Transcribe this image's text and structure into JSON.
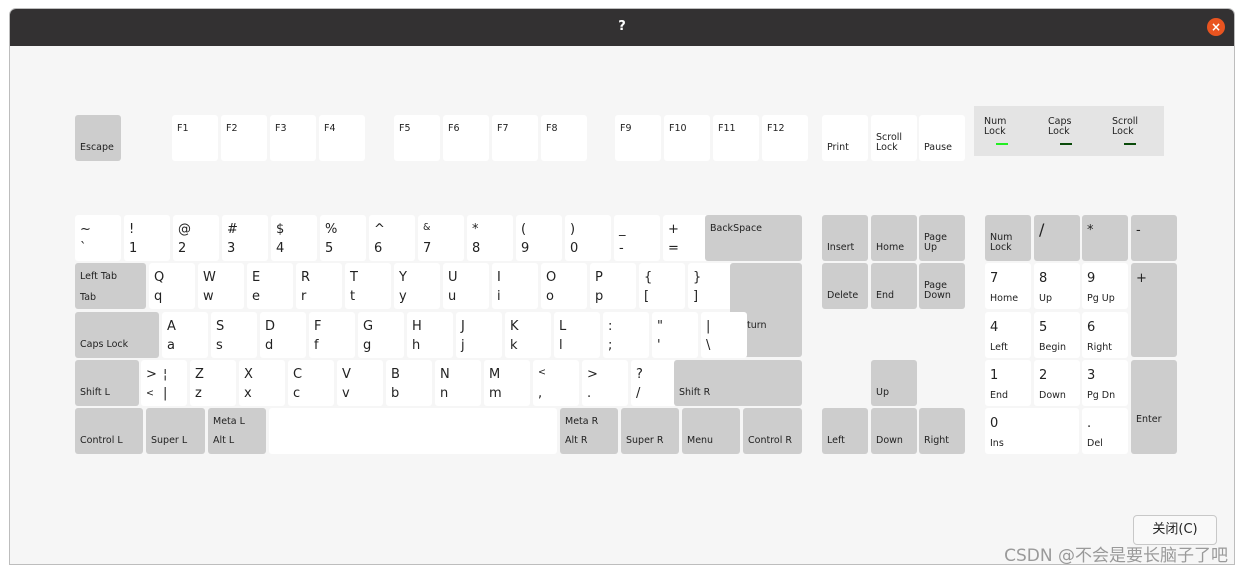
{
  "window": {
    "title": "?",
    "close_label": "×"
  },
  "colors": {
    "accent_close": "#e95420",
    "led_on": "#22ee22",
    "led_off": "#0a4a0a",
    "mod_key": "#cdcdcd",
    "key": "#ffffff"
  },
  "fn_row": {
    "escape": "Escape",
    "f": [
      "F1",
      "F2",
      "F3",
      "F4",
      "F5",
      "F6",
      "F7",
      "F8",
      "F9",
      "F10",
      "F11",
      "F12"
    ],
    "print": "Print",
    "scroll_lock": "Scroll\nLock",
    "pause": "Pause"
  },
  "leds": [
    {
      "label": "Num\nLock",
      "state": "on"
    },
    {
      "label": "Caps\nLock",
      "state": "off"
    },
    {
      "label": "Scroll\nLock",
      "state": "off"
    }
  ],
  "number_row": [
    {
      "top": "~",
      "bottom": "`"
    },
    {
      "top": "!",
      "bottom": "1"
    },
    {
      "top": "@",
      "bottom": "2"
    },
    {
      "top": "#",
      "bottom": "3"
    },
    {
      "top": "$",
      "bottom": "4"
    },
    {
      "top": "%",
      "bottom": "5"
    },
    {
      "top": "^",
      "bottom": "6"
    },
    {
      "top": "&",
      "bottom": "7"
    },
    {
      "top": "*",
      "bottom": "8"
    },
    {
      "top": "(",
      "bottom": "9"
    },
    {
      "top": ")",
      "bottom": "0"
    },
    {
      "top": "_",
      "bottom": "-"
    },
    {
      "top": "+",
      "bottom": "="
    }
  ],
  "backspace": "BackSpace",
  "tab": {
    "top": "Left Tab",
    "bottom": "Tab"
  },
  "qwerty_row": [
    {
      "top": "Q",
      "bottom": "q"
    },
    {
      "top": "W",
      "bottom": "w"
    },
    {
      "top": "E",
      "bottom": "e"
    },
    {
      "top": "R",
      "bottom": "r"
    },
    {
      "top": "T",
      "bottom": "t"
    },
    {
      "top": "Y",
      "bottom": "y"
    },
    {
      "top": "U",
      "bottom": "u"
    },
    {
      "top": "I",
      "bottom": "i"
    },
    {
      "top": "O",
      "bottom": "o"
    },
    {
      "top": "P",
      "bottom": "p"
    },
    {
      "top": "{",
      "bottom": "["
    },
    {
      "top": "}",
      "bottom": "]"
    }
  ],
  "caps_lock": "Caps Lock",
  "home_row": [
    {
      "top": "A",
      "bottom": "a"
    },
    {
      "top": "S",
      "bottom": "s"
    },
    {
      "top": "D",
      "bottom": "d"
    },
    {
      "top": "F",
      "bottom": "f"
    },
    {
      "top": "G",
      "bottom": "g"
    },
    {
      "top": "H",
      "bottom": "h"
    },
    {
      "top": "J",
      "bottom": "j"
    },
    {
      "top": "K",
      "bottom": "k"
    },
    {
      "top": "L",
      "bottom": "l"
    },
    {
      "top": ":",
      "bottom": ";"
    },
    {
      "top": "\"",
      "bottom": "'"
    },
    {
      "top": "|",
      "bottom": "\\"
    }
  ],
  "return": "Return",
  "shift_l": "Shift L",
  "iso_key": {
    "top": ">",
    "top2": "¦",
    "bottom": "<",
    "bottom2": "|"
  },
  "bottom_row_letters": [
    {
      "top": "Z",
      "bottom": "z"
    },
    {
      "top": "X",
      "bottom": "x"
    },
    {
      "top": "C",
      "bottom": "c"
    },
    {
      "top": "V",
      "bottom": "v"
    },
    {
      "top": "B",
      "bottom": "b"
    },
    {
      "top": "N",
      "bottom": "n"
    },
    {
      "top": "M",
      "bottom": "m"
    },
    {
      "top": "<",
      "bottom": ","
    },
    {
      "top": ">",
      "bottom": "."
    },
    {
      "top": "?",
      "bottom": "/"
    }
  ],
  "shift_r": "Shift R",
  "space_row": {
    "control_l": "Control L",
    "super_l": "Super L",
    "meta_l": "Meta L",
    "alt_l": "Alt L",
    "meta_r": "Meta R",
    "alt_r": "Alt R",
    "super_r": "Super R",
    "menu": "Menu",
    "control_r": "Control R"
  },
  "nav": {
    "insert": "Insert",
    "home": "Home",
    "page_up": "Page\nUp",
    "delete": "Delete",
    "end": "End",
    "page_down": "Page\nDown",
    "up": "Up",
    "left": "Left",
    "down": "Down",
    "right": "Right"
  },
  "numpad": {
    "num_lock": "Num\nLock",
    "divide": "/",
    "multiply": "*",
    "minus": "-",
    "plus": "+",
    "enter": "Enter",
    "keys": [
      {
        "main": "7",
        "sub": "Home"
      },
      {
        "main": "8",
        "sub": "Up"
      },
      {
        "main": "9",
        "sub": "Pg Up"
      },
      {
        "main": "4",
        "sub": "Left"
      },
      {
        "main": "5",
        "sub": "Begin"
      },
      {
        "main": "6",
        "sub": "Right"
      },
      {
        "main": "1",
        "sub": "End"
      },
      {
        "main": "2",
        "sub": "Down"
      },
      {
        "main": "3",
        "sub": "Pg Dn"
      },
      {
        "main": "0",
        "sub": "Ins"
      },
      {
        "main": ".",
        "sub": "Del"
      }
    ]
  },
  "close_button": "关闭(C)",
  "watermark": "CSDN @不会是要长脑子了吧"
}
